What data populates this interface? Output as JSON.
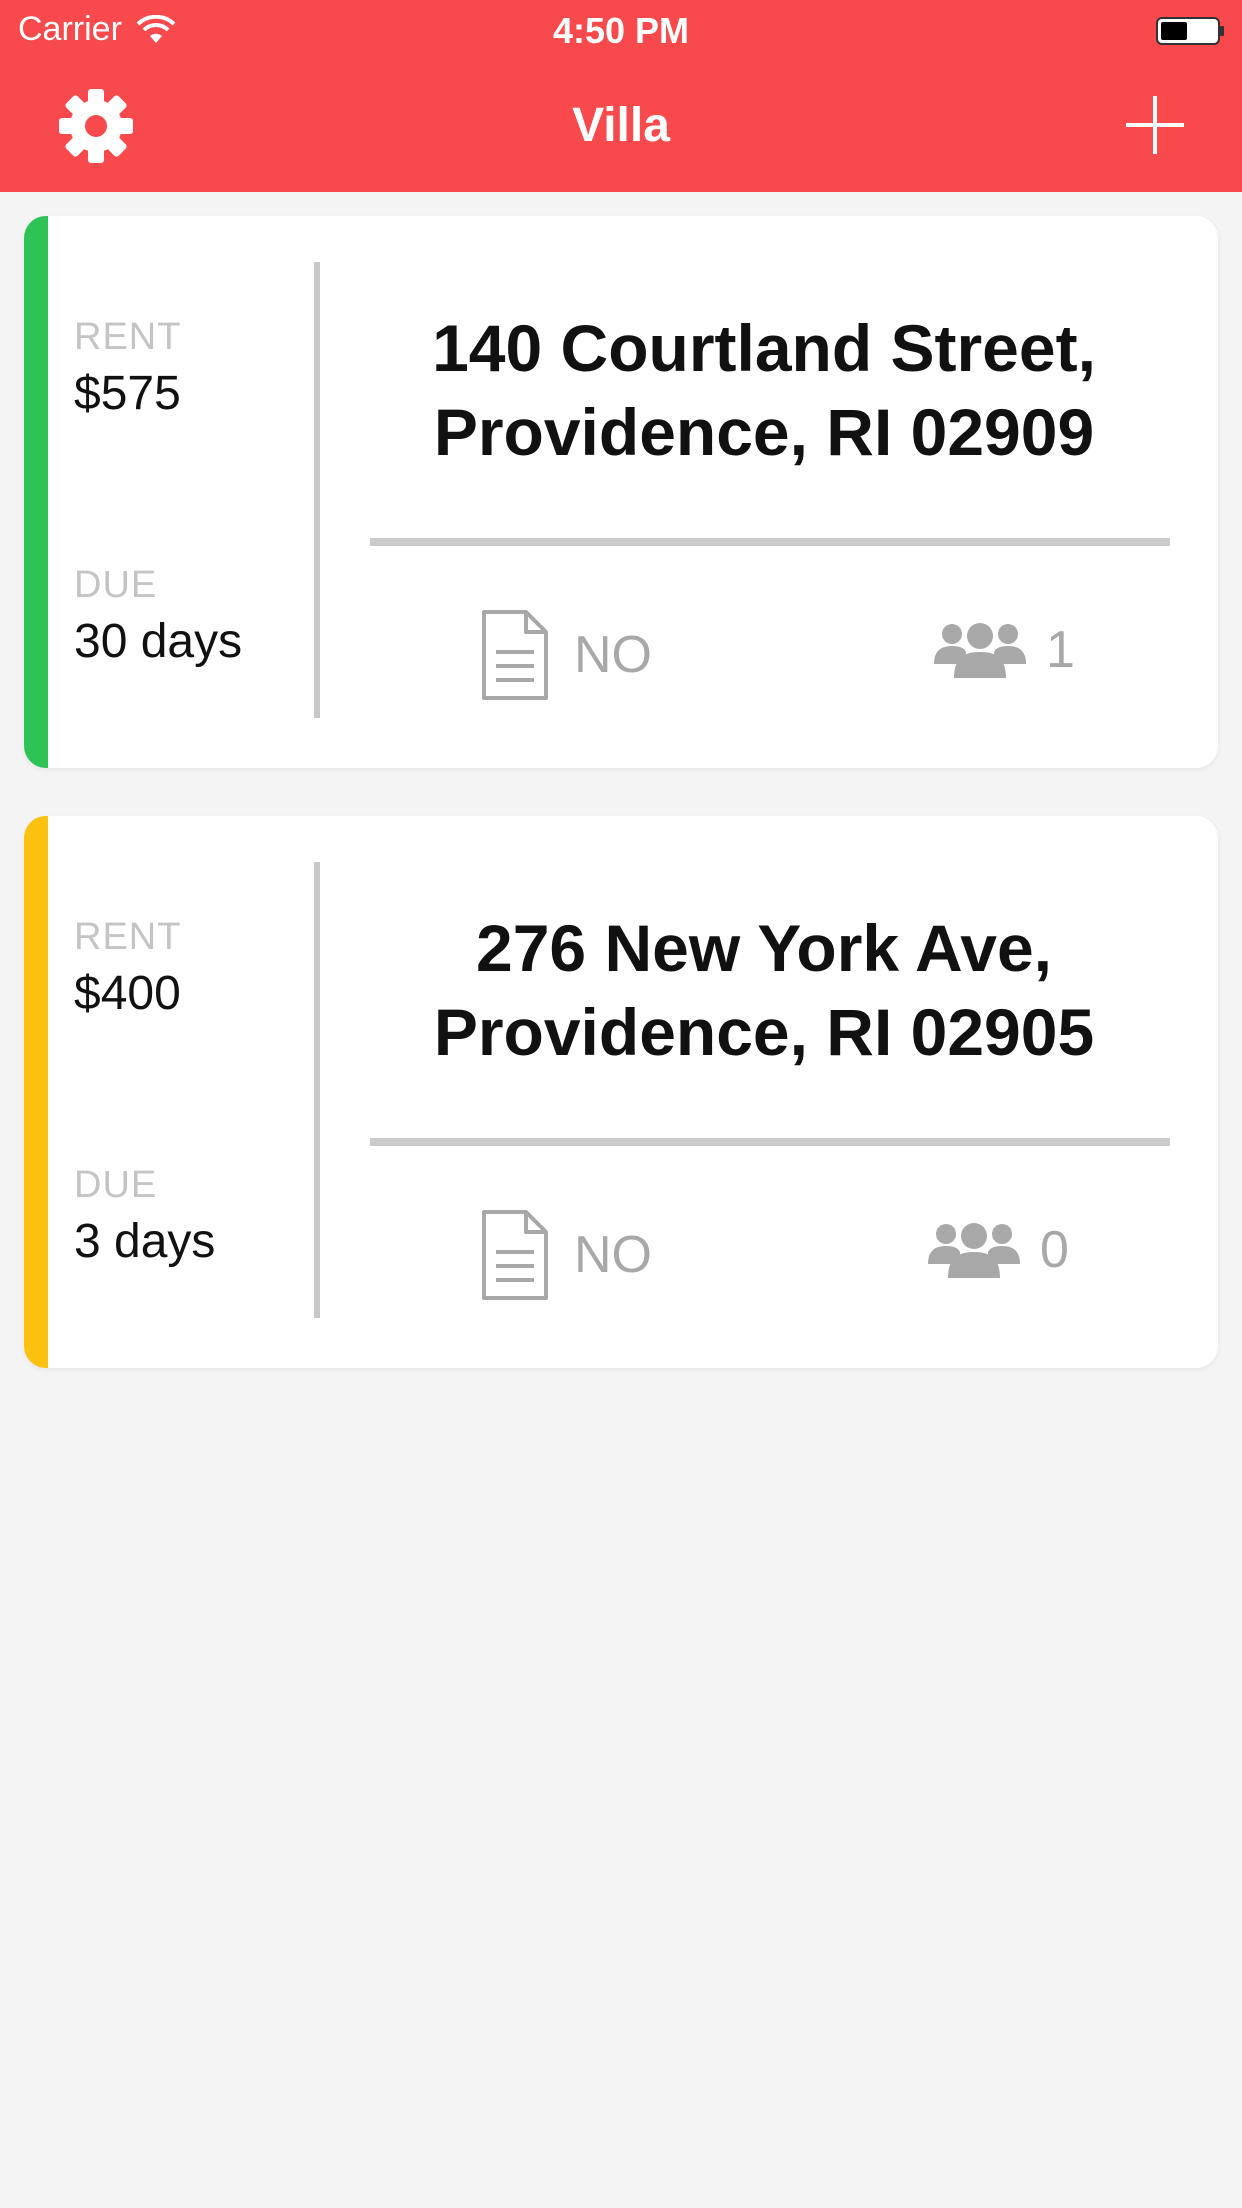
{
  "status_bar": {
    "carrier": "Carrier",
    "time": "4:50 PM",
    "icons": [
      "wifi-icon",
      "battery-icon"
    ]
  },
  "nav": {
    "title": "Villa",
    "left_icon": "gear-icon",
    "right_icon": "plus-icon",
    "background_color": "#f84a4c"
  },
  "properties": [
    {
      "rent_label": "RENT",
      "rent": "$575",
      "due_label": "DUE",
      "due": "30 days",
      "address_line1": "140 Courtland Street,",
      "address_line2": "Providence, RI 02909",
      "lease_status": "NO",
      "tenant_count": "1",
      "accent_color": "#2dc455"
    },
    {
      "rent_label": "RENT",
      "rent": "$400",
      "due_label": "DUE",
      "due": "3 days",
      "address_line1": "276 New York Ave,",
      "address_line2": "Providence, RI 02905",
      "lease_status": "NO",
      "tenant_count": "0",
      "accent_color": "#fcc011"
    }
  ]
}
